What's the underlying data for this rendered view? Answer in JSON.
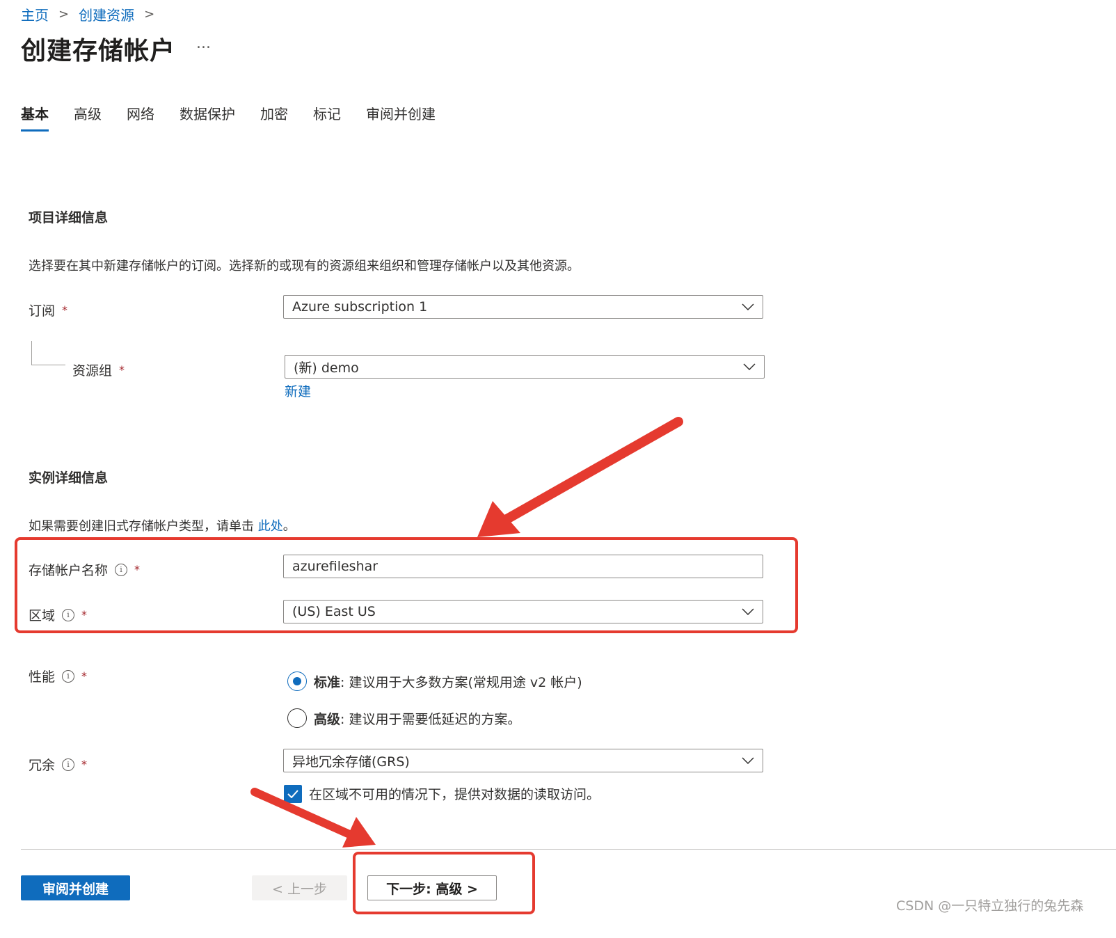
{
  "breadcrumb": {
    "home": "主页",
    "create_resource": "创建资源",
    "sep": ">"
  },
  "page": {
    "title": "创建存储帐户",
    "more": "..."
  },
  "tabs": [
    {
      "label": "基本",
      "active": true
    },
    {
      "label": "高级",
      "active": false
    },
    {
      "label": "网络",
      "active": false
    },
    {
      "label": "数据保护",
      "active": false
    },
    {
      "label": "加密",
      "active": false
    },
    {
      "label": "标记",
      "active": false
    },
    {
      "label": "审阅并创建",
      "active": false
    }
  ],
  "project": {
    "heading": "项目详细信息",
    "description": "选择要在其中新建存储帐户的订阅。选择新的或现有的资源组来组织和管理存储帐户以及其他资源。",
    "subscription_label": "订阅",
    "subscription_value": "Azure subscription 1",
    "resource_group_label": "资源组",
    "resource_group_value": "(新) demo",
    "create_new_link": "新建",
    "required_mark": "*"
  },
  "instance": {
    "heading": "实例详细信息",
    "legacy_text": "如果需要创建旧式存储帐户类型，请单击 ",
    "legacy_link": "此处",
    "legacy_end": "。",
    "account_name_label": "存储帐户名称",
    "account_name_value": "azurefileshar",
    "region_label": "区域",
    "region_value": "(US) East US",
    "performance_label": "性能",
    "perf_standard_bold": "标准",
    "perf_standard_text": ": 建议用于大多数方案(常规用途 v2 帐户)",
    "perf_premium_bold": "高级",
    "perf_premium_text": ": 建议用于需要低延迟的方案。",
    "performance_selected": "标准",
    "redundancy_label": "冗余",
    "redundancy_value": "异地冗余存储(GRS)",
    "read_access_text": "在区域不可用的情况下，提供对数据的读取访问。",
    "read_access_checked": true
  },
  "footer": {
    "review_create": "审阅并创建",
    "previous": "< 上一步",
    "next": "下一步: 高级 >"
  },
  "watermark": "CSDN @一只特立独行的兔先森",
  "colors": {
    "accent": "#0f6cbd",
    "annotation_red": "#e53a2f",
    "required": "#a4262c"
  }
}
